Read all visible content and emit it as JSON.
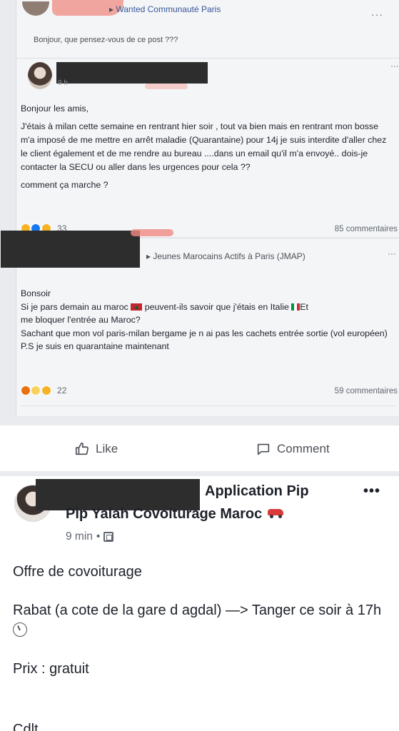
{
  "card1": {
    "group_name": "Wanted Communauté Paris",
    "question": "Bonjour, que pensez-vous de ce post ???",
    "post": {
      "time": "9 h",
      "paragraphs": [
        "Bonjour les amis,",
        "J'étais à milan cette semaine en rentrant hier soir , tout va bien mais en rentrant mon bosse m'a imposé de me mettre en arrêt maladie (Quarantaine) pour 14j je suis interdite d'aller chez le client également et de me rendre au bureau ....dans un email qu'il m'a envoyé.. dois-je contacter la SECU ou aller dans les urgences pour cela ??",
        "comment ça marche ?"
      ],
      "reactions_count": "33",
      "comments_count": "85 commentaires"
    }
  },
  "card2": {
    "group_name": "Jeunes Marocains Actifs à Paris (JMAP)",
    "lines": {
      "l1": "Bonsoir",
      "l2a": "Si je pars demain au maroc",
      "l2b": "peuvent-ils savoir que j'étais en Italie",
      "l2c": "Et",
      "l3": "me bloquer l'entrée au Maroc?",
      "l4": "Sachant que mon vol paris-milan bergame je n ai pas les cachets entrée sortie (vol européen)",
      "l5": "P.S je suis en quarantaine maintenant"
    },
    "reactions_count": "22",
    "comments_count": "59 commentaires"
  },
  "actions": {
    "like_label": "Like",
    "comment_label": "Comment"
  },
  "post3": {
    "title_line1": "Application Pip",
    "title_line2": "Pip Yalah Covoiturage Maroc",
    "time": "9 min",
    "body": {
      "p1": "Offre de covoiturage",
      "p2": "Rabat (a cote de la gare d agdal)  —> Tanger ce soir à 17h",
      "p3": "Prix : gratuit"
    },
    "cut_text": "Cdlt"
  },
  "icons": [
    "chevron-icon",
    "like-icon",
    "comment-icon",
    "clock-icon",
    "car-icon",
    "globe-icon",
    "more-icon"
  ],
  "colors": {
    "link_blue": "#385898",
    "like_blue": "#1877f2",
    "text": "#1d2129",
    "muted": "#606770"
  }
}
